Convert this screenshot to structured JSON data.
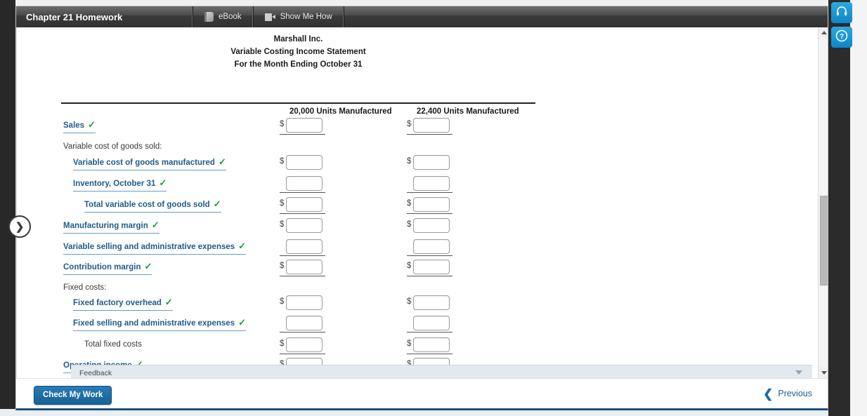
{
  "window": {
    "tabs": [
      {
        "name": "assignment-title",
        "label": "Chapter 21 Homework",
        "icon": null
      },
      {
        "name": "ebook",
        "label": "eBook",
        "icon": "book-icon"
      },
      {
        "name": "show-me-how",
        "label": "Show Me How",
        "icon": "video-icon"
      }
    ]
  },
  "statement": {
    "company": "Marshall Inc.",
    "report_title": "Variable Costing Income Statement",
    "period": "For the Month Ending October 31",
    "columns": [
      "20,000 Units Manufactured",
      "22,400 Units Manufactured"
    ],
    "rows": [
      {
        "label": "Sales",
        "type": "link",
        "checked": true,
        "indent": 0,
        "dollar": true,
        "rule": "single",
        "value_c1": "",
        "value_c2": ""
      },
      {
        "label": "Variable cost of goods sold:",
        "type": "plain",
        "checked": false,
        "indent": 0,
        "dollar": false,
        "rule": "none",
        "value_c1": null,
        "value_c2": null
      },
      {
        "label": "Variable cost of goods manufactured",
        "type": "link",
        "checked": true,
        "indent": 1,
        "dollar": true,
        "rule": "none",
        "value_c1": "",
        "value_c2": ""
      },
      {
        "label": "Inventory, October 31",
        "type": "link",
        "checked": true,
        "indent": 1,
        "dollar": false,
        "rule": "single",
        "value_c1": "",
        "value_c2": ""
      },
      {
        "label": "Total variable cost of goods sold",
        "type": "link",
        "checked": true,
        "indent": 2,
        "dollar": true,
        "rule": "single",
        "value_c1": "",
        "value_c2": ""
      },
      {
        "label": "Manufacturing margin",
        "type": "link",
        "checked": true,
        "indent": 0,
        "dollar": true,
        "rule": "none",
        "value_c1": "",
        "value_c2": ""
      },
      {
        "label": "Variable selling and administrative expenses",
        "type": "link",
        "checked": true,
        "indent": 0,
        "dollar": false,
        "rule": "single",
        "value_c1": "",
        "value_c2": ""
      },
      {
        "label": "Contribution margin",
        "type": "link",
        "checked": true,
        "indent": 0,
        "dollar": true,
        "rule": "single",
        "value_c1": "",
        "value_c2": ""
      },
      {
        "label": "Fixed costs:",
        "type": "plain",
        "checked": false,
        "indent": 0,
        "dollar": false,
        "rule": "none",
        "value_c1": null,
        "value_c2": null
      },
      {
        "label": "Fixed factory overhead",
        "type": "link",
        "checked": true,
        "indent": 1,
        "dollar": true,
        "rule": "none",
        "value_c1": "",
        "value_c2": ""
      },
      {
        "label": "Fixed selling and administrative expenses",
        "type": "link",
        "checked": true,
        "indent": 1,
        "dollar": false,
        "rule": "single",
        "value_c1": "",
        "value_c2": ""
      },
      {
        "label": "Total fixed costs",
        "type": "plain",
        "checked": false,
        "indent": 2,
        "dollar": true,
        "rule": "single",
        "value_c1": "",
        "value_c2": ""
      },
      {
        "label": "Operating income",
        "type": "link",
        "checked": true,
        "indent": 0,
        "dollar": true,
        "rule": "double",
        "value_c1": "",
        "value_c2": ""
      }
    ],
    "check_glyph": "✓"
  },
  "feedback": {
    "label": "Feedback",
    "caret": "chevron-down-icon"
  },
  "actions": {
    "check_my_work": "Check My Work",
    "previous": "Previous",
    "previous_chevron": "❮"
  },
  "expander": {
    "glyph": "❯"
  },
  "right_rail": {
    "support_icon": "headset-icon",
    "help_icon": "question-mark-icon",
    "help_glyph": "?"
  },
  "scrollbar": {
    "up_arrow": "triangle-up-icon",
    "down_arrow": "triangle-down-icon"
  },
  "colors": {
    "link": "#1f5c8b",
    "check": "#1d9b3c",
    "button": "#176196",
    "rail": "#0f86c6"
  }
}
